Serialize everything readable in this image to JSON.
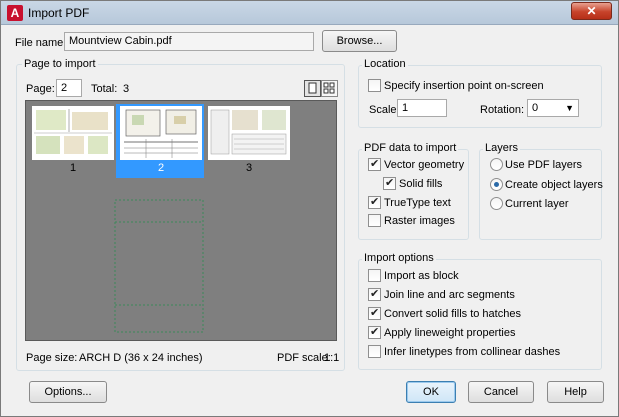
{
  "window": {
    "title": "Import PDF",
    "close_glyph": "✕"
  },
  "file": {
    "label": "File name:",
    "value": "Mountview Cabin.pdf",
    "browse_label": "Browse..."
  },
  "page_to_import": {
    "title": "Page to import",
    "page_label": "Page:",
    "page_value": "2",
    "total_label": "Total:",
    "total_value": "3",
    "thumbnails": [
      {
        "number": "1",
        "selected": false
      },
      {
        "number": "2",
        "selected": true
      },
      {
        "number": "3",
        "selected": false
      }
    ],
    "page_size_label": "Page size:",
    "page_size_value": "ARCH D (36 x 24 inches)",
    "pdf_scale_label": "PDF scale:",
    "pdf_scale_value": "1:1"
  },
  "location": {
    "title": "Location",
    "specify_label": "Specify insertion point on-screen",
    "specify_checked": false,
    "scale_label": "Scale:",
    "scale_value": "1",
    "rotation_label": "Rotation:",
    "rotation_value": "0"
  },
  "pdf_data": {
    "title": "PDF data to import",
    "vector_label": "Vector geometry",
    "vector_checked": true,
    "solid_label": "Solid fills",
    "solid_checked": true,
    "truetype_label": "TrueType text",
    "truetype_checked": true,
    "raster_label": "Raster images",
    "raster_checked": false
  },
  "layers": {
    "title": "Layers",
    "options": [
      "Use PDF layers",
      "Create object layers",
      "Current layer"
    ],
    "selected_index": 1
  },
  "import_options": {
    "title": "Import options",
    "items": [
      {
        "label": "Import as block",
        "checked": false
      },
      {
        "label": "Join line and arc segments",
        "checked": true
      },
      {
        "label": "Convert solid fills to hatches",
        "checked": true
      },
      {
        "label": "Apply lineweight properties",
        "checked": true
      },
      {
        "label": "Infer linetypes from collinear dashes",
        "checked": false
      }
    ]
  },
  "buttons": {
    "options": "Options...",
    "ok": "OK",
    "cancel": "Cancel",
    "help": "Help"
  },
  "icons": {
    "app": "autocad-icon",
    "close": "close-icon",
    "single_view": "single-page-view-icon",
    "grid_view": "thumbnail-grid-view-icon",
    "dropdown": "chevron-down-icon"
  },
  "colors": {
    "selection": "#3399ff",
    "preview_bg": "#7f7f7f",
    "close": "#c7432b"
  }
}
